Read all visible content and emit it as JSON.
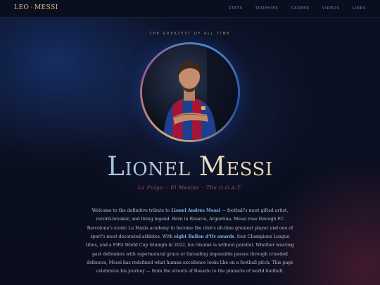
{
  "brand": {
    "part1": "LEO",
    "dot": "·",
    "part2": "MESSI"
  },
  "nav": {
    "items": [
      {
        "label": "STATS"
      },
      {
        "label": "TROPHIES"
      },
      {
        "label": "CAREER"
      },
      {
        "label": "VIDEOS"
      },
      {
        "label": "LINKS"
      }
    ]
  },
  "hero": {
    "eyebrow": "THE GREATEST OF ALL TIME",
    "name": "Lionel Messi",
    "nicknames": [
      "La Pulga",
      "El Mesías",
      "The G.O.A.T."
    ],
    "nickname_separator": "·"
  },
  "intro": {
    "t1": "Welcome to the definitive tribute to ",
    "name": "Lionel Andrés Messi",
    "t2": " — football's most gifted artist, record-breaker, and living legend. Born in Rosario, Argentina, Messi rose through FC Barcelona's iconic La Masia academy to become the club's all-time greatest player and one of sport's most decorated athletes. With ",
    "awards": "eight Ballon d'Or awards",
    "t3": ", four Champions League titles, and a FIFA World Cup triumph in 2022, his résumé is without parallel. Whether weaving past defenders with supernatural grace or threading impossible passes through crowded defences, Messi has redefined what human excellence looks like on a football pitch. This page celebrates his journey — from the streets of Rosario to the pinnacle of world football."
  },
  "colors": {
    "gold": "#e2c27a",
    "blue_accent": "#7fb3ef",
    "nickname_red": "#b04a5c",
    "background": "#0a0f22"
  },
  "icons": {
    "portrait": "player-portrait-image"
  }
}
